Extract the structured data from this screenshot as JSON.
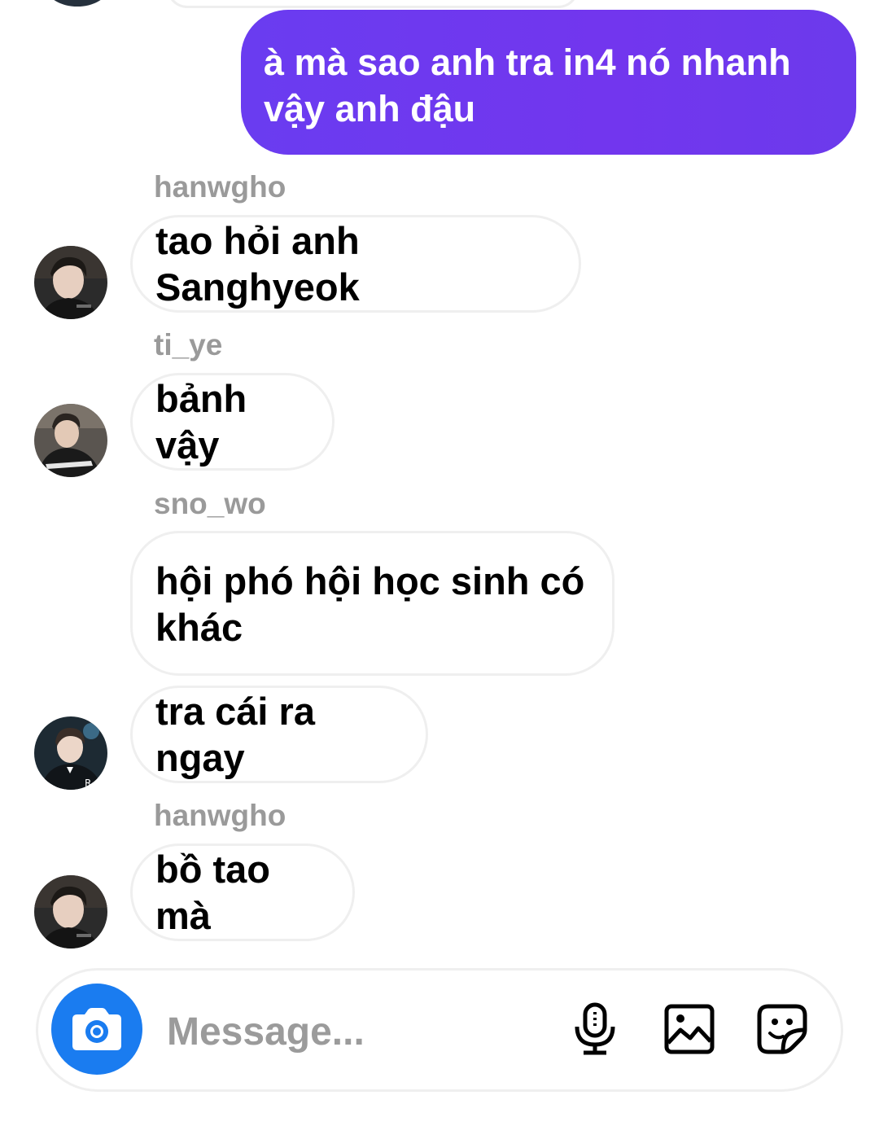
{
  "sent_message": {
    "text": "à mà sao anh tra in4 nó nhanh vậy anh đậu",
    "color": "#6f38ee"
  },
  "messages": [
    {
      "sender": "hanwgho",
      "text": "tao hỏi anh Sanghyeok"
    },
    {
      "sender": "ti_ye",
      "text": "bảnh vậy"
    },
    {
      "sender": "sno_wo",
      "text": "hội phó hội học sinh có khác"
    },
    {
      "sender": "",
      "text": "tra cái ra ngay"
    },
    {
      "sender": "hanwgho",
      "text": "bồ tao mà"
    }
  ],
  "composer": {
    "placeholder": "Message...",
    "camera_icon": "camera-icon",
    "mic_icon": "microphone-icon",
    "gallery_icon": "image-icon",
    "sticker_icon": "sticker-icon",
    "accent": "#1a7cf0"
  }
}
